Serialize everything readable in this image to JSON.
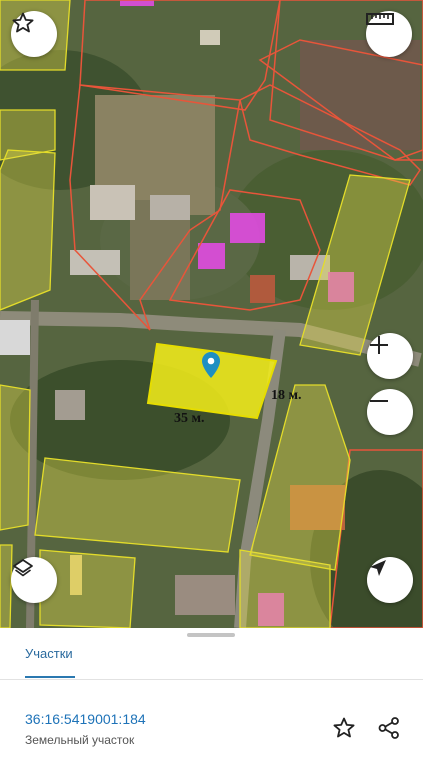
{
  "map": {
    "length_label": "35 м.",
    "width_label": "18 м.",
    "parcel_color": "#f4ee1a",
    "parcel_border_color": "#e6dd00",
    "boundary_color": "#e8553a",
    "building_highlight_color": "#e04be0"
  },
  "controls": {
    "favorite_icon": "star-outline-icon",
    "ruler_icon": "ruler-icon",
    "zoom_in_icon": "plus-icon",
    "zoom_out_icon": "minus-icon",
    "layers_icon": "layers-icon",
    "locate_icon": "navigation-arrow-icon"
  },
  "sheet": {
    "tab_label": "Участки",
    "cadastral_number": "36:16:5419001:184",
    "parcel_type": "Земельный участок"
  }
}
